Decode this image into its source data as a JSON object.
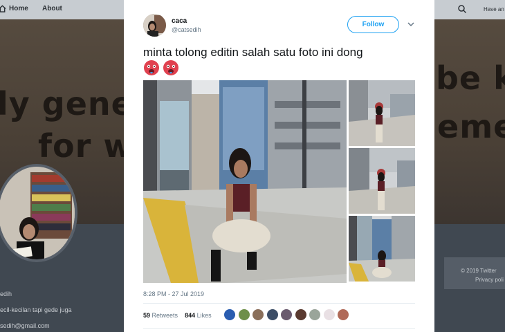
{
  "nav": {
    "home_label": "Home",
    "about_label": "About",
    "right_text": "Have an"
  },
  "banner": {
    "line1": "ly gener",
    "line2": "for w",
    "line3": "be kn",
    "line4": "emes"
  },
  "profile": {
    "bio_name": "edih",
    "bio_text": "ecil-kecilan tapi gede juga",
    "bio_email": "sedih@gmail.com",
    "footer_line1": "© 2019 Twitter",
    "footer_line2": "Privacy poli"
  },
  "tweet": {
    "display_name": "caca",
    "handle": "@catsedih",
    "follow_label": "Follow",
    "text": "minta tolong editin salah satu foto ini dong",
    "emojis": [
      "hot-face-emoji",
      "hot-face-emoji"
    ],
    "timestamp": "8:28 PM - 27 Jul 2019",
    "retweets_count": "59",
    "retweets_label": "Retweets",
    "likes_count": "844",
    "likes_label": "Likes",
    "likers": [
      "#2a5db0",
      "#6e8f4a",
      "#8a6f5a",
      "#3c4d66",
      "#6a5a6e",
      "#5a3a30",
      "#9aa59a",
      "#e9e0e4",
      "#b06a58"
    ]
  }
}
